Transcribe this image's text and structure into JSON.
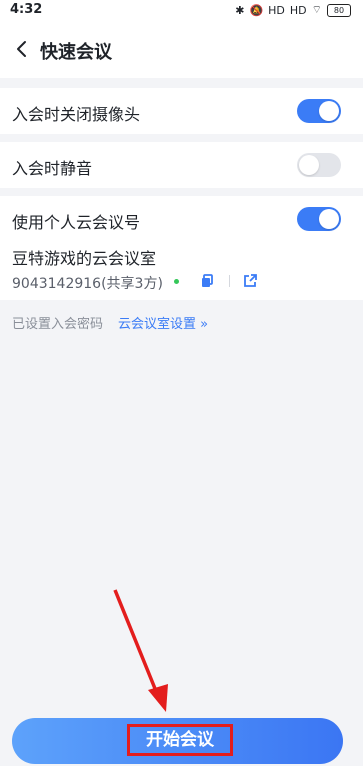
{
  "status_bar": {
    "time": "4:32",
    "battery": "80",
    "signal_labels": [
      "HD",
      "HD"
    ]
  },
  "header": {
    "title": "快速会议"
  },
  "settings": {
    "camera_off_label": "入会时关闭摄像头",
    "camera_off_on": true,
    "mute_label": "入会时静音",
    "mute_on": false,
    "personal_id_label": "使用个人云会议号",
    "personal_id_on": true,
    "room_name": "豆特游戏的云会议室",
    "room_id": "9043142916(共享3方)"
  },
  "footer_note": {
    "password_text": "已设置入会密码",
    "room_settings_link": "云会议室设置 »"
  },
  "start_button": {
    "label": "开始会议"
  },
  "colors": {
    "accent": "#3b7cf6",
    "highlight": "#e31d1d",
    "background": "#f3f4f7"
  },
  "icons": [
    "back-icon",
    "bluetooth-icon",
    "mute-icon",
    "signal-icon",
    "wifi-icon",
    "battery-icon",
    "copy-icon",
    "share-icon"
  ]
}
